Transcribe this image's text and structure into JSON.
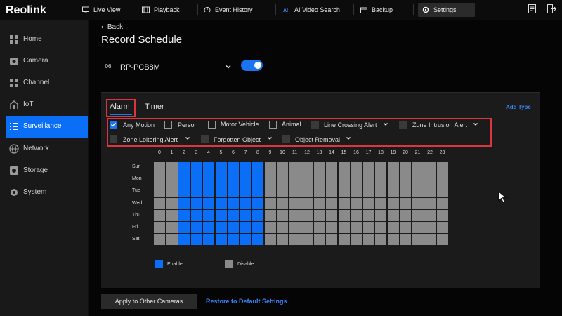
{
  "app": {
    "brand": "Reolink"
  },
  "topnav": [
    {
      "label": "Live View",
      "icon": "monitor-icon"
    },
    {
      "label": "Playback",
      "icon": "playback-icon"
    },
    {
      "label": "Event History",
      "icon": "event-history-icon"
    },
    {
      "label": "AI Video Search",
      "icon": "ai-icon"
    },
    {
      "label": "Backup",
      "icon": "backup-icon"
    },
    {
      "label": "Settings",
      "icon": "gear-icon",
      "active": true
    }
  ],
  "sidebar": {
    "items": [
      {
        "label": "Home",
        "icon": "home-icon"
      },
      {
        "label": "Camera",
        "icon": "camera-icon"
      },
      {
        "label": "Channel",
        "icon": "channel-icon"
      },
      {
        "label": "IoT",
        "icon": "iot-icon"
      },
      {
        "label": "Surveillance",
        "icon": "list-icon",
        "active": true
      },
      {
        "label": "Network",
        "icon": "globe-icon"
      },
      {
        "label": "Storage",
        "icon": "storage-icon"
      },
      {
        "label": "System",
        "icon": "gear-icon"
      }
    ]
  },
  "page": {
    "back_label": "Back",
    "title": "Record Schedule",
    "camera_number": "06",
    "camera_name": "RP-PCB8M",
    "record_enabled": true
  },
  "tabs": {
    "alarm": "Alarm",
    "timer": "Timer",
    "add_type": "Add Type"
  },
  "alarm_types": [
    {
      "label": "Any Motion",
      "checked": true,
      "dropdown": false
    },
    {
      "label": "Person",
      "checked": false,
      "dropdown": false
    },
    {
      "label": "Motor Vehicle",
      "checked": false,
      "dropdown": false
    },
    {
      "label": "Animal",
      "checked": false,
      "dropdown": false
    },
    {
      "label": "Line Crossing Alert",
      "checked": false,
      "dropdown": true
    },
    {
      "label": "Zone Intrusion Alert",
      "checked": false,
      "dropdown": true
    },
    {
      "label": "Zone Loitering Alert",
      "checked": false,
      "dropdown": true
    },
    {
      "label": "Forgotten Object",
      "checked": false,
      "dropdown": true
    },
    {
      "label": "Object Removal",
      "checked": false,
      "dropdown": true
    }
  ],
  "schedule": {
    "hours": [
      "0",
      "1",
      "2",
      "3",
      "4",
      "5",
      "6",
      "7",
      "8",
      "9",
      "10",
      "11",
      "12",
      "13",
      "14",
      "15",
      "16",
      "17",
      "18",
      "19",
      "20",
      "21",
      "22",
      "23"
    ],
    "days": [
      "Sun",
      "Mon",
      "Tue",
      "Wed",
      "Thu",
      "Fri",
      "Sat"
    ],
    "enabled_hours": [
      2,
      3,
      4,
      5,
      6,
      7,
      8
    ],
    "colors": {
      "enable": "#0b6ef7",
      "disable": "#8a8a8a"
    }
  },
  "legend": {
    "enable": "Enable",
    "disable": "Disable"
  },
  "footer": {
    "apply": "Apply to Other Cameras",
    "restore": "Restore to Default Settings"
  }
}
